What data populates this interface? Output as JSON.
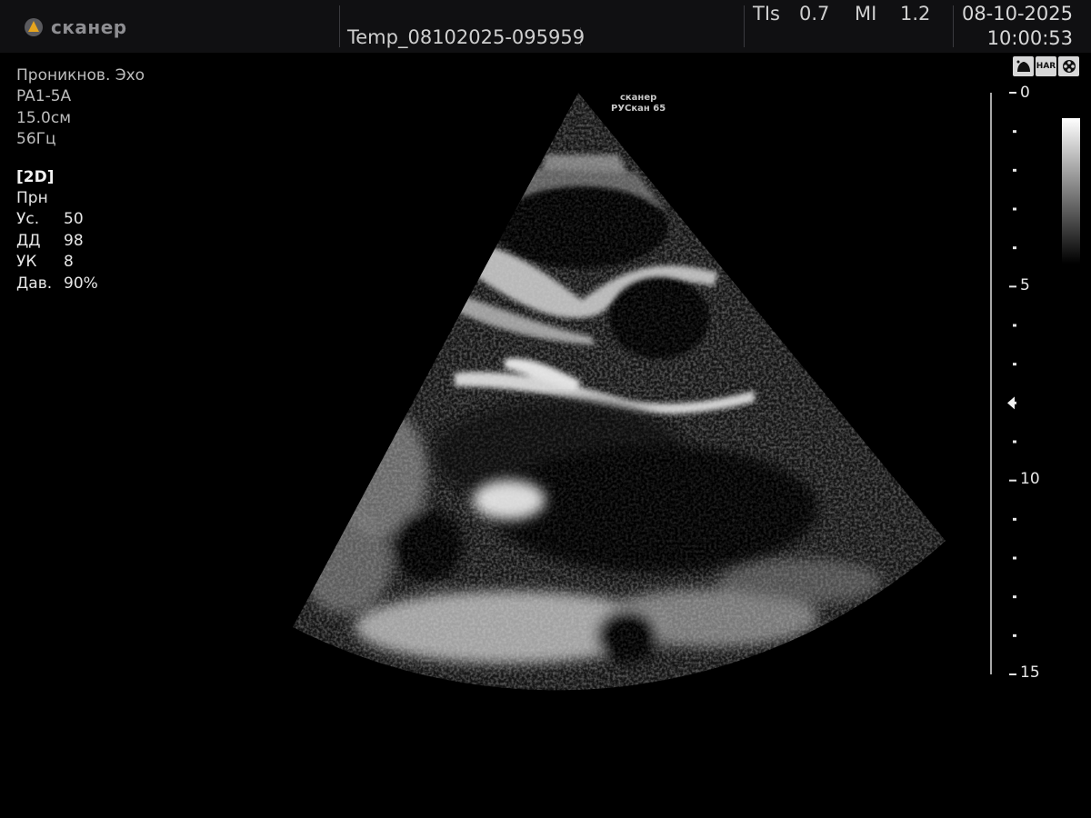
{
  "header": {
    "logo_text": "сканер",
    "patient_id": "Temp_08102025-095959",
    "tis_label": "TIs",
    "tis_value": "0.7",
    "mi_label": "MI",
    "mi_value": "1.2",
    "date": "08-10-2025",
    "time": "10:00:53"
  },
  "params": {
    "preset": "Проникнов. Эхо",
    "probe": "PA1-5A",
    "depth": "15.0см",
    "frame_rate": "56Гц",
    "mode": "[2D]",
    "line_label": "Прн",
    "rows": [
      {
        "key": "Ус.",
        "value": "50"
      },
      {
        "key": "ДД",
        "value": "98"
      },
      {
        "key": "УК",
        "value": "8"
      },
      {
        "key": "Дав.",
        "value": "90%"
      }
    ]
  },
  "image_marker": {
    "line1": "сканер",
    "line2": "РУСкан 65"
  },
  "icons": [
    "probe-icon",
    "har-icon",
    "film-reel-icon"
  ],
  "icon_labels": {
    "har": "HAR"
  },
  "depth_scale": {
    "labels": [
      "0",
      "5",
      "10",
      "15"
    ],
    "focus_depth_cm": 8
  },
  "colors": {
    "background": "#000000",
    "header": "#101012",
    "logo_accent": "#e6a41e"
  }
}
